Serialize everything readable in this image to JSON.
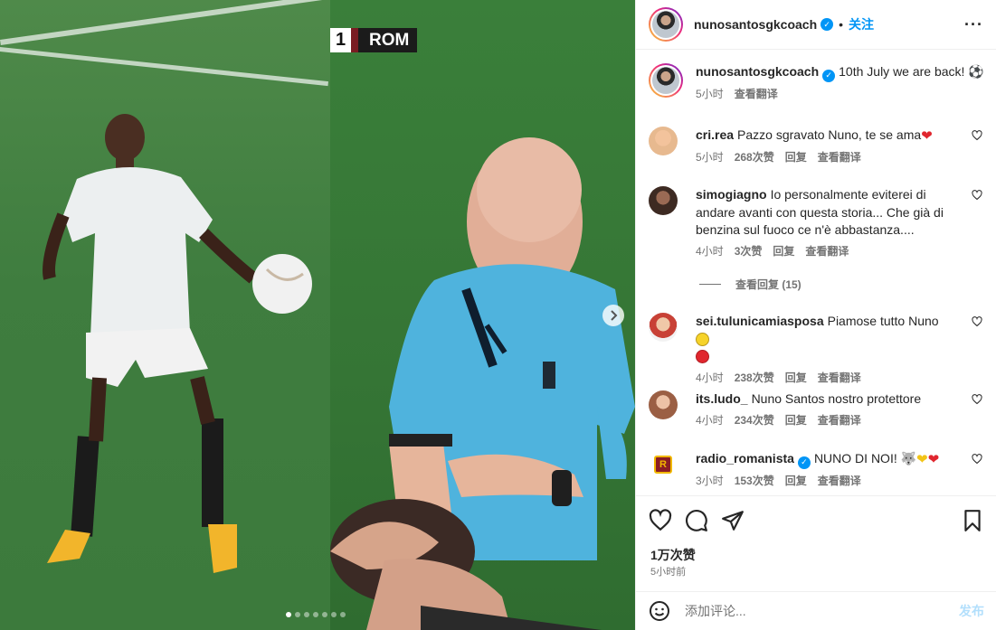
{
  "media": {
    "scoreboard": {
      "score": "1",
      "team": "ROM"
    },
    "carousel": {
      "dots": 7,
      "active_dot": 0
    }
  },
  "header": {
    "username": "nunosantosgkcoach",
    "separator": "•",
    "follow_label": "关注",
    "more_label": "···"
  },
  "caption": {
    "username": "nunosantosgkcoach",
    "text": "10th July we are back! ⚽",
    "time": "5小时",
    "translate": "查看翻译"
  },
  "comments": [
    {
      "user": "cri.rea",
      "text": "Pazzo sgravato Nuno, te se ama",
      "time": "5小时",
      "likes": "268次赞",
      "reply": "回复",
      "translate": "查看翻译",
      "avatar_color": "#e9b089"
    },
    {
      "user": "simogiagno",
      "text": "Io personalmente eviterei di andare avanti con questa storia... Che già di benzina sul fuoco ce n'è abbastanza....",
      "time": "4小时",
      "likes": "3次赞",
      "reply": "回复",
      "translate": "查看翻译",
      "avatar_color": "#5a3e30"
    },
    {
      "user": "sei.tulunicamiasposa",
      "text": "Piamose tutto Nuno",
      "time": "4小时",
      "likes": "238次赞",
      "reply": "回复",
      "translate": "查看翻译",
      "avatar_color": "#c2453b"
    },
    {
      "user": "its.ludo_",
      "text": "Nuno Santos nostro protettore",
      "time": "4小时",
      "likes": "234次赞",
      "reply": "回复",
      "translate": "查看翻译",
      "avatar_color": "#b7896d"
    },
    {
      "user": "radio_romanista",
      "text": "NUNO DI NOI!",
      "time": "3小时",
      "likes": "153次赞",
      "reply": "回复",
      "translate": "查看翻译",
      "avatar_color": "#8b1d24"
    }
  ],
  "view_replies": "查看回复 (15)",
  "footer": {
    "likes": "1万次赞",
    "time_ago": "5小时前",
    "comment_placeholder": "添加评论...",
    "post_label": "发布"
  },
  "colors": {
    "accent": "#0095f6",
    "text": "#262626",
    "muted": "#737373"
  }
}
